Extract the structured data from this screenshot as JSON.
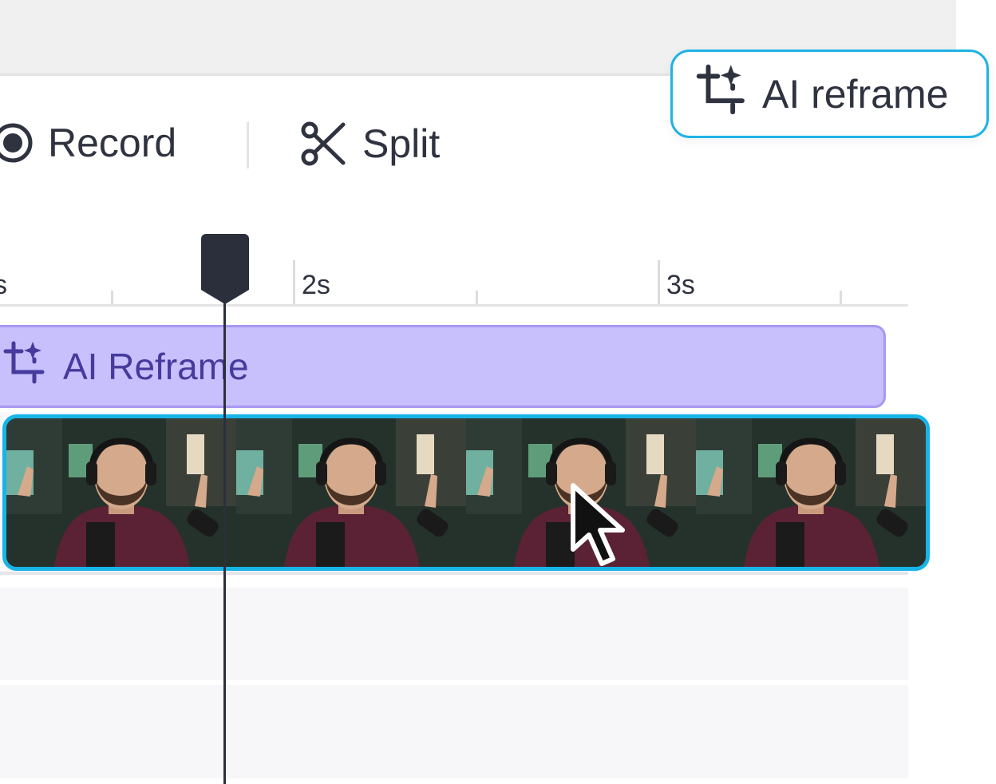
{
  "toolbar": {
    "record_label": "Record",
    "split_label": "Split",
    "ai_reframe_label": "AI reframe"
  },
  "ruler": {
    "labels": [
      "s",
      "2s",
      "3s"
    ]
  },
  "tracks": {
    "effect_clip_label": "AI Reframe",
    "video_frame_count": 4
  },
  "colors": {
    "accent_border": "#18b4e8",
    "effect_fill": "#c7c0fc",
    "effect_text": "#463a9c",
    "text": "#2f3340"
  }
}
